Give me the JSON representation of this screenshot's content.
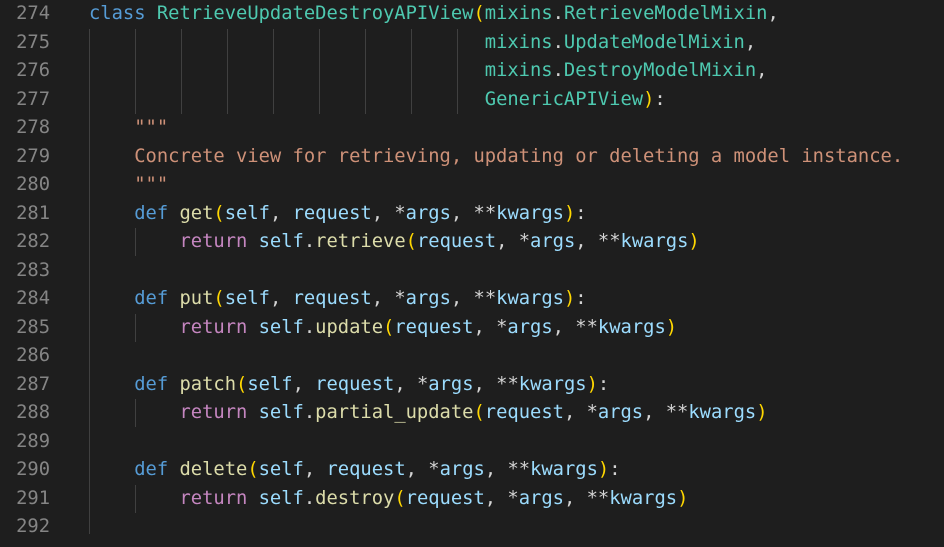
{
  "editor": {
    "language": "python",
    "colors": {
      "background": "#1e1e1e",
      "line_number": "#858585",
      "keyword": "#569cd6",
      "control_keyword": "#c586c0",
      "class_name": "#4ec9b0",
      "function": "#dcdcaa",
      "parameter": "#9cdcfe",
      "string": "#ce9178",
      "default_text": "#d4d4d4",
      "bracket_gold": "#ffd700",
      "bracket_purple": "#da70d6"
    },
    "lines": [
      {
        "number": "274",
        "tokens": [
          {
            "t": "class",
            "c": "k"
          },
          {
            "t": " ",
            "c": "d"
          },
          {
            "t": "RetrieveUpdateDestroyAPIView",
            "c": "cls"
          },
          {
            "t": "(",
            "c": "b1"
          },
          {
            "t": "mixins",
            "c": "cls"
          },
          {
            "t": ".",
            "c": "d"
          },
          {
            "t": "RetrieveModelMixin",
            "c": "cls"
          },
          {
            "t": ",",
            "c": "d"
          }
        ]
      },
      {
        "number": "275",
        "tokens": [
          {
            "t": "                                   ",
            "c": "d"
          },
          {
            "t": "mixins",
            "c": "cls"
          },
          {
            "t": ".",
            "c": "d"
          },
          {
            "t": "UpdateModelMixin",
            "c": "cls"
          },
          {
            "t": ",",
            "c": "d"
          }
        ]
      },
      {
        "number": "276",
        "tokens": [
          {
            "t": "                                   ",
            "c": "d"
          },
          {
            "t": "mixins",
            "c": "cls"
          },
          {
            "t": ".",
            "c": "d"
          },
          {
            "t": "DestroyModelMixin",
            "c": "cls"
          },
          {
            "t": ",",
            "c": "d"
          }
        ]
      },
      {
        "number": "277",
        "tokens": [
          {
            "t": "                                   ",
            "c": "d"
          },
          {
            "t": "GenericAPIView",
            "c": "cls"
          },
          {
            "t": ")",
            "c": "b1"
          },
          {
            "t": ":",
            "c": "d"
          }
        ]
      },
      {
        "number": "278",
        "tokens": [
          {
            "t": "    \"\"\"",
            "c": "s"
          }
        ]
      },
      {
        "number": "279",
        "tokens": [
          {
            "t": "    Concrete view for retrieving, updating or deleting a model instance.",
            "c": "s"
          }
        ]
      },
      {
        "number": "280",
        "tokens": [
          {
            "t": "    \"\"\"",
            "c": "s"
          }
        ]
      },
      {
        "number": "281",
        "tokens": [
          {
            "t": "    ",
            "c": "d"
          },
          {
            "t": "def",
            "c": "k"
          },
          {
            "t": " ",
            "c": "d"
          },
          {
            "t": "get",
            "c": "f"
          },
          {
            "t": "(",
            "c": "b1"
          },
          {
            "t": "self",
            "c": "p"
          },
          {
            "t": ", ",
            "c": "d"
          },
          {
            "t": "request",
            "c": "p"
          },
          {
            "t": ", ",
            "c": "d"
          },
          {
            "t": "*",
            "c": "d"
          },
          {
            "t": "args",
            "c": "p"
          },
          {
            "t": ", ",
            "c": "d"
          },
          {
            "t": "**",
            "c": "d"
          },
          {
            "t": "kwargs",
            "c": "p"
          },
          {
            "t": ")",
            "c": "b1"
          },
          {
            "t": ":",
            "c": "d"
          }
        ]
      },
      {
        "number": "282",
        "tokens": [
          {
            "t": "        ",
            "c": "d"
          },
          {
            "t": "return",
            "c": "kc"
          },
          {
            "t": " ",
            "c": "d"
          },
          {
            "t": "self",
            "c": "p"
          },
          {
            "t": ".",
            "c": "d"
          },
          {
            "t": "retrieve",
            "c": "f"
          },
          {
            "t": "(",
            "c": "b1"
          },
          {
            "t": "request",
            "c": "p"
          },
          {
            "t": ", ",
            "c": "d"
          },
          {
            "t": "*",
            "c": "d"
          },
          {
            "t": "args",
            "c": "p"
          },
          {
            "t": ", ",
            "c": "d"
          },
          {
            "t": "**",
            "c": "d"
          },
          {
            "t": "kwargs",
            "c": "p"
          },
          {
            "t": ")",
            "c": "b1"
          }
        ]
      },
      {
        "number": "283",
        "tokens": []
      },
      {
        "number": "284",
        "tokens": [
          {
            "t": "    ",
            "c": "d"
          },
          {
            "t": "def",
            "c": "k"
          },
          {
            "t": " ",
            "c": "d"
          },
          {
            "t": "put",
            "c": "f"
          },
          {
            "t": "(",
            "c": "b1"
          },
          {
            "t": "self",
            "c": "p"
          },
          {
            "t": ", ",
            "c": "d"
          },
          {
            "t": "request",
            "c": "p"
          },
          {
            "t": ", ",
            "c": "d"
          },
          {
            "t": "*",
            "c": "d"
          },
          {
            "t": "args",
            "c": "p"
          },
          {
            "t": ", ",
            "c": "d"
          },
          {
            "t": "**",
            "c": "d"
          },
          {
            "t": "kwargs",
            "c": "p"
          },
          {
            "t": ")",
            "c": "b1"
          },
          {
            "t": ":",
            "c": "d"
          }
        ]
      },
      {
        "number": "285",
        "tokens": [
          {
            "t": "        ",
            "c": "d"
          },
          {
            "t": "return",
            "c": "kc"
          },
          {
            "t": " ",
            "c": "d"
          },
          {
            "t": "self",
            "c": "p"
          },
          {
            "t": ".",
            "c": "d"
          },
          {
            "t": "update",
            "c": "f"
          },
          {
            "t": "(",
            "c": "b1"
          },
          {
            "t": "request",
            "c": "p"
          },
          {
            "t": ", ",
            "c": "d"
          },
          {
            "t": "*",
            "c": "d"
          },
          {
            "t": "args",
            "c": "p"
          },
          {
            "t": ", ",
            "c": "d"
          },
          {
            "t": "**",
            "c": "d"
          },
          {
            "t": "kwargs",
            "c": "p"
          },
          {
            "t": ")",
            "c": "b1"
          }
        ]
      },
      {
        "number": "286",
        "tokens": []
      },
      {
        "number": "287",
        "tokens": [
          {
            "t": "    ",
            "c": "d"
          },
          {
            "t": "def",
            "c": "k"
          },
          {
            "t": " ",
            "c": "d"
          },
          {
            "t": "patch",
            "c": "f"
          },
          {
            "t": "(",
            "c": "b1"
          },
          {
            "t": "self",
            "c": "p"
          },
          {
            "t": ", ",
            "c": "d"
          },
          {
            "t": "request",
            "c": "p"
          },
          {
            "t": ", ",
            "c": "d"
          },
          {
            "t": "*",
            "c": "d"
          },
          {
            "t": "args",
            "c": "p"
          },
          {
            "t": ", ",
            "c": "d"
          },
          {
            "t": "**",
            "c": "d"
          },
          {
            "t": "kwargs",
            "c": "p"
          },
          {
            "t": ")",
            "c": "b1"
          },
          {
            "t": ":",
            "c": "d"
          }
        ]
      },
      {
        "number": "288",
        "tokens": [
          {
            "t": "        ",
            "c": "d"
          },
          {
            "t": "return",
            "c": "kc"
          },
          {
            "t": " ",
            "c": "d"
          },
          {
            "t": "self",
            "c": "p"
          },
          {
            "t": ".",
            "c": "d"
          },
          {
            "t": "partial_update",
            "c": "f"
          },
          {
            "t": "(",
            "c": "b1"
          },
          {
            "t": "request",
            "c": "p"
          },
          {
            "t": ", ",
            "c": "d"
          },
          {
            "t": "*",
            "c": "d"
          },
          {
            "t": "args",
            "c": "p"
          },
          {
            "t": ", ",
            "c": "d"
          },
          {
            "t": "**",
            "c": "d"
          },
          {
            "t": "kwargs",
            "c": "p"
          },
          {
            "t": ")",
            "c": "b1"
          }
        ]
      },
      {
        "number": "289",
        "tokens": []
      },
      {
        "number": "290",
        "tokens": [
          {
            "t": "    ",
            "c": "d"
          },
          {
            "t": "def",
            "c": "k"
          },
          {
            "t": " ",
            "c": "d"
          },
          {
            "t": "delete",
            "c": "f"
          },
          {
            "t": "(",
            "c": "b1"
          },
          {
            "t": "self",
            "c": "p"
          },
          {
            "t": ", ",
            "c": "d"
          },
          {
            "t": "request",
            "c": "p"
          },
          {
            "t": ", ",
            "c": "d"
          },
          {
            "t": "*",
            "c": "d"
          },
          {
            "t": "args",
            "c": "p"
          },
          {
            "t": ", ",
            "c": "d"
          },
          {
            "t": "**",
            "c": "d"
          },
          {
            "t": "kwargs",
            "c": "p"
          },
          {
            "t": ")",
            "c": "b1"
          },
          {
            "t": ":",
            "c": "d"
          }
        ]
      },
      {
        "number": "291",
        "tokens": [
          {
            "t": "        ",
            "c": "d"
          },
          {
            "t": "return",
            "c": "kc"
          },
          {
            "t": " ",
            "c": "d"
          },
          {
            "t": "self",
            "c": "p"
          },
          {
            "t": ".",
            "c": "d"
          },
          {
            "t": "destroy",
            "c": "f"
          },
          {
            "t": "(",
            "c": "b1"
          },
          {
            "t": "request",
            "c": "p"
          },
          {
            "t": ", ",
            "c": "d"
          },
          {
            "t": "*",
            "c": "d"
          },
          {
            "t": "args",
            "c": "p"
          },
          {
            "t": ", ",
            "c": "d"
          },
          {
            "t": "**",
            "c": "d"
          },
          {
            "t": "kwargs",
            "c": "p"
          },
          {
            "t": ")",
            "c": "b1"
          }
        ]
      },
      {
        "number": "292",
        "tokens": []
      }
    ]
  }
}
